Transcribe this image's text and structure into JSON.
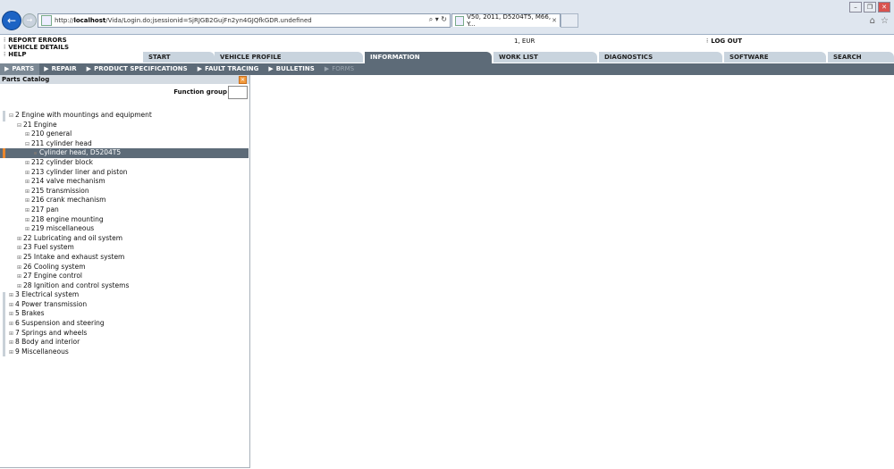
{
  "browser": {
    "url_prefix": "http://",
    "url_host": "localhost",
    "url_rest": "/Vida/Login.do;jsessionid=SjRJGB2GujFn2yn4GJQfkGDR.undefined",
    "search_glyph": "⌕ ▾ ↻",
    "tab_title": "V50, 2011, D5204T5, M66, Y...",
    "tab_close": "✕",
    "window_controls": [
      "–",
      "❐",
      "✕"
    ],
    "right_icons": [
      "⌂",
      "☆"
    ],
    "back_glyph": "←",
    "forward_glyph": "→"
  },
  "header": {
    "links": [
      {
        "label": "REPORT ERRORS"
      },
      {
        "label": "VEHICLE DETAILS"
      },
      {
        "label": "HELP"
      }
    ],
    "link_bullet": "⁝",
    "currency": "1, EUR",
    "logout_bullet": "⁝",
    "logout": "LOG OUT"
  },
  "main_tabs": [
    {
      "label": "START",
      "active": false
    },
    {
      "label": "VEHICLE PROFILE",
      "active": false
    },
    {
      "label": "INFORMATION",
      "active": true
    },
    {
      "label": "WORK LIST",
      "active": false
    },
    {
      "label": "DIAGNOSTICS",
      "active": false
    },
    {
      "label": "SOFTWARE",
      "active": false
    },
    {
      "label": "SEARCH",
      "active": false
    }
  ],
  "sub_tabs": [
    {
      "label": "PARTS",
      "state": "active"
    },
    {
      "label": "REPAIR",
      "state": "normal"
    },
    {
      "label": "PRODUCT SPECIFICATIONS",
      "state": "normal"
    },
    {
      "label": "FAULT TRACING",
      "state": "normal"
    },
    {
      "label": "BULLETINS",
      "state": "normal"
    },
    {
      "label": "FORMS",
      "state": "disabled"
    }
  ],
  "sub_tab_arrow": "▶",
  "panel": {
    "title": "Parts Catalog",
    "close_glyph": "✕",
    "function_group_label": "Function group",
    "function_group_value": ""
  },
  "tree": [
    {
      "label": "2 Engine with mountings and equipment",
      "level": 0,
      "toggle": "⊟"
    },
    {
      "label": "21 Engine",
      "level": 1,
      "toggle": "⊟"
    },
    {
      "label": "210 general",
      "level": 2,
      "toggle": "⊞"
    },
    {
      "label": "211 cylinder head",
      "level": 2,
      "toggle": "⊟"
    },
    {
      "label": "Cylinder head, D5204T5",
      "level": 3,
      "toggle": "▪",
      "selected": true
    },
    {
      "label": "212 cylinder block",
      "level": 2,
      "toggle": "⊞"
    },
    {
      "label": "213 cylinder liner and piston",
      "level": 2,
      "toggle": "⊞"
    },
    {
      "label": "214 valve mechanism",
      "level": 2,
      "toggle": "⊞"
    },
    {
      "label": "215 transmission",
      "level": 2,
      "toggle": "⊞"
    },
    {
      "label": "216 crank mechanism",
      "level": 2,
      "toggle": "⊞"
    },
    {
      "label": "217 pan",
      "level": 2,
      "toggle": "⊞"
    },
    {
      "label": "218 engine mounting",
      "level": 2,
      "toggle": "⊞"
    },
    {
      "label": "219 miscellaneous",
      "level": 2,
      "toggle": "⊞"
    },
    {
      "label": "22 Lubricating and oil system",
      "level": 1,
      "toggle": "⊞"
    },
    {
      "label": "23 Fuel system",
      "level": 1,
      "toggle": "⊞"
    },
    {
      "label": "25 Intake and exhaust system",
      "level": 1,
      "toggle": "⊞"
    },
    {
      "label": "26 Cooling system",
      "level": 1,
      "toggle": "⊞"
    },
    {
      "label": "27 Engine control",
      "level": 1,
      "toggle": "⊞"
    },
    {
      "label": "28 Ignition and control systems",
      "level": 1,
      "toggle": "⊞"
    },
    {
      "label": "3 Electrical system",
      "level": 0,
      "toggle": "⊞"
    },
    {
      "label": "4 Power transmission",
      "level": 0,
      "toggle": "⊞"
    },
    {
      "label": "5 Brakes",
      "level": 0,
      "toggle": "⊞"
    },
    {
      "label": "6 Suspension and steering",
      "level": 0,
      "toggle": "⊞"
    },
    {
      "label": "7 Springs and wheels",
      "level": 0,
      "toggle": "⊞"
    },
    {
      "label": "8 Body and interior",
      "level": 0,
      "toggle": "⊞"
    },
    {
      "label": "9 Miscellaneous",
      "level": 0,
      "toggle": "⊞"
    }
  ],
  "colors": {
    "accent_blue": "#1c63c4",
    "tab_active": "#5d6b78",
    "tab_inactive": "#c9d4de",
    "selection_marker": "#e9862e"
  }
}
